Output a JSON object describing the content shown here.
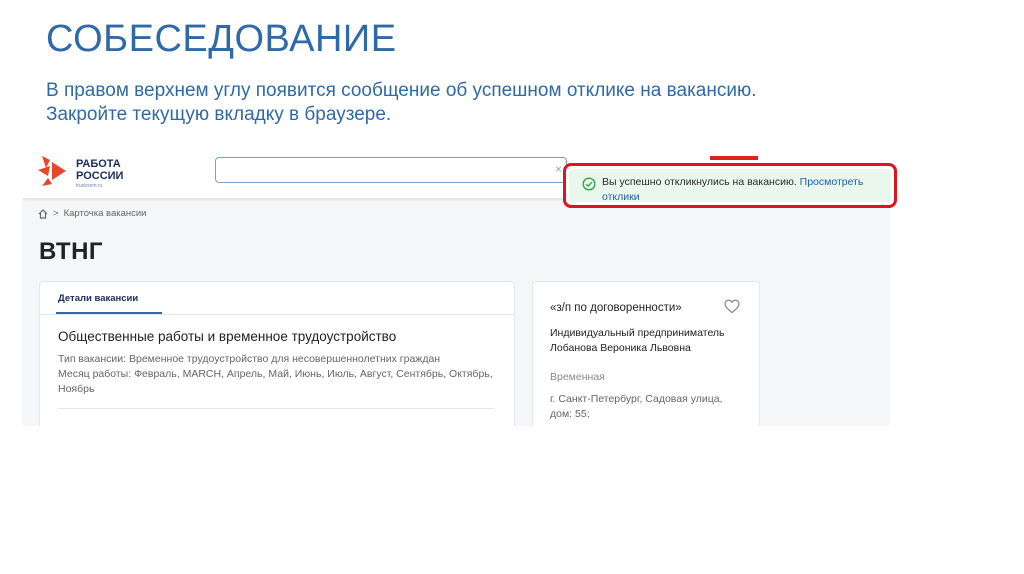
{
  "slide": {
    "title": "СОБЕСЕДОВАНИЕ",
    "instruction_line1": "В правом верхнем углу появится сообщение об успешном отклике на вакансию.",
    "instruction_line2": "Закройте текущую вкладку в браузере."
  },
  "header": {
    "logo_line1": "РАБОТА",
    "logo_line2": "РОССИИ",
    "logo_sub": "trudvsem.ru",
    "search_value": "",
    "search_clear": "×"
  },
  "breadcrumb": {
    "home_icon": "home-icon",
    "separator": ">",
    "current": "Карточка вакансии"
  },
  "vacancy": {
    "title": "ВТНГ",
    "tab_label": "Детали вакансии",
    "job_title": "Общественные работы и временное трудоустройство",
    "type_line": "Тип вакансии: Временное трудоустройство для несовершеннолетних граждан",
    "months_line": "Месяц работы: Февраль, MARCH, Апрель, Май, Июнь, Июль, Август, Сентябрь, Октябрь, Ноябрь"
  },
  "side_card": {
    "salary": "«з/п по договоренности»",
    "employer": "Индивидуальный предприниматель Лобанова Вероника Львовна",
    "employment": "Временная",
    "address": "г. Санкт-Петербург, Садовая улица, дом: 55;"
  },
  "toast": {
    "message": "Вы успешно откликнулись на вакансию.",
    "link": "Просмотреть отклики",
    "icon": "check-circle-icon",
    "highlight_color": "#e0131f",
    "background_color": "#e9f7ec"
  }
}
